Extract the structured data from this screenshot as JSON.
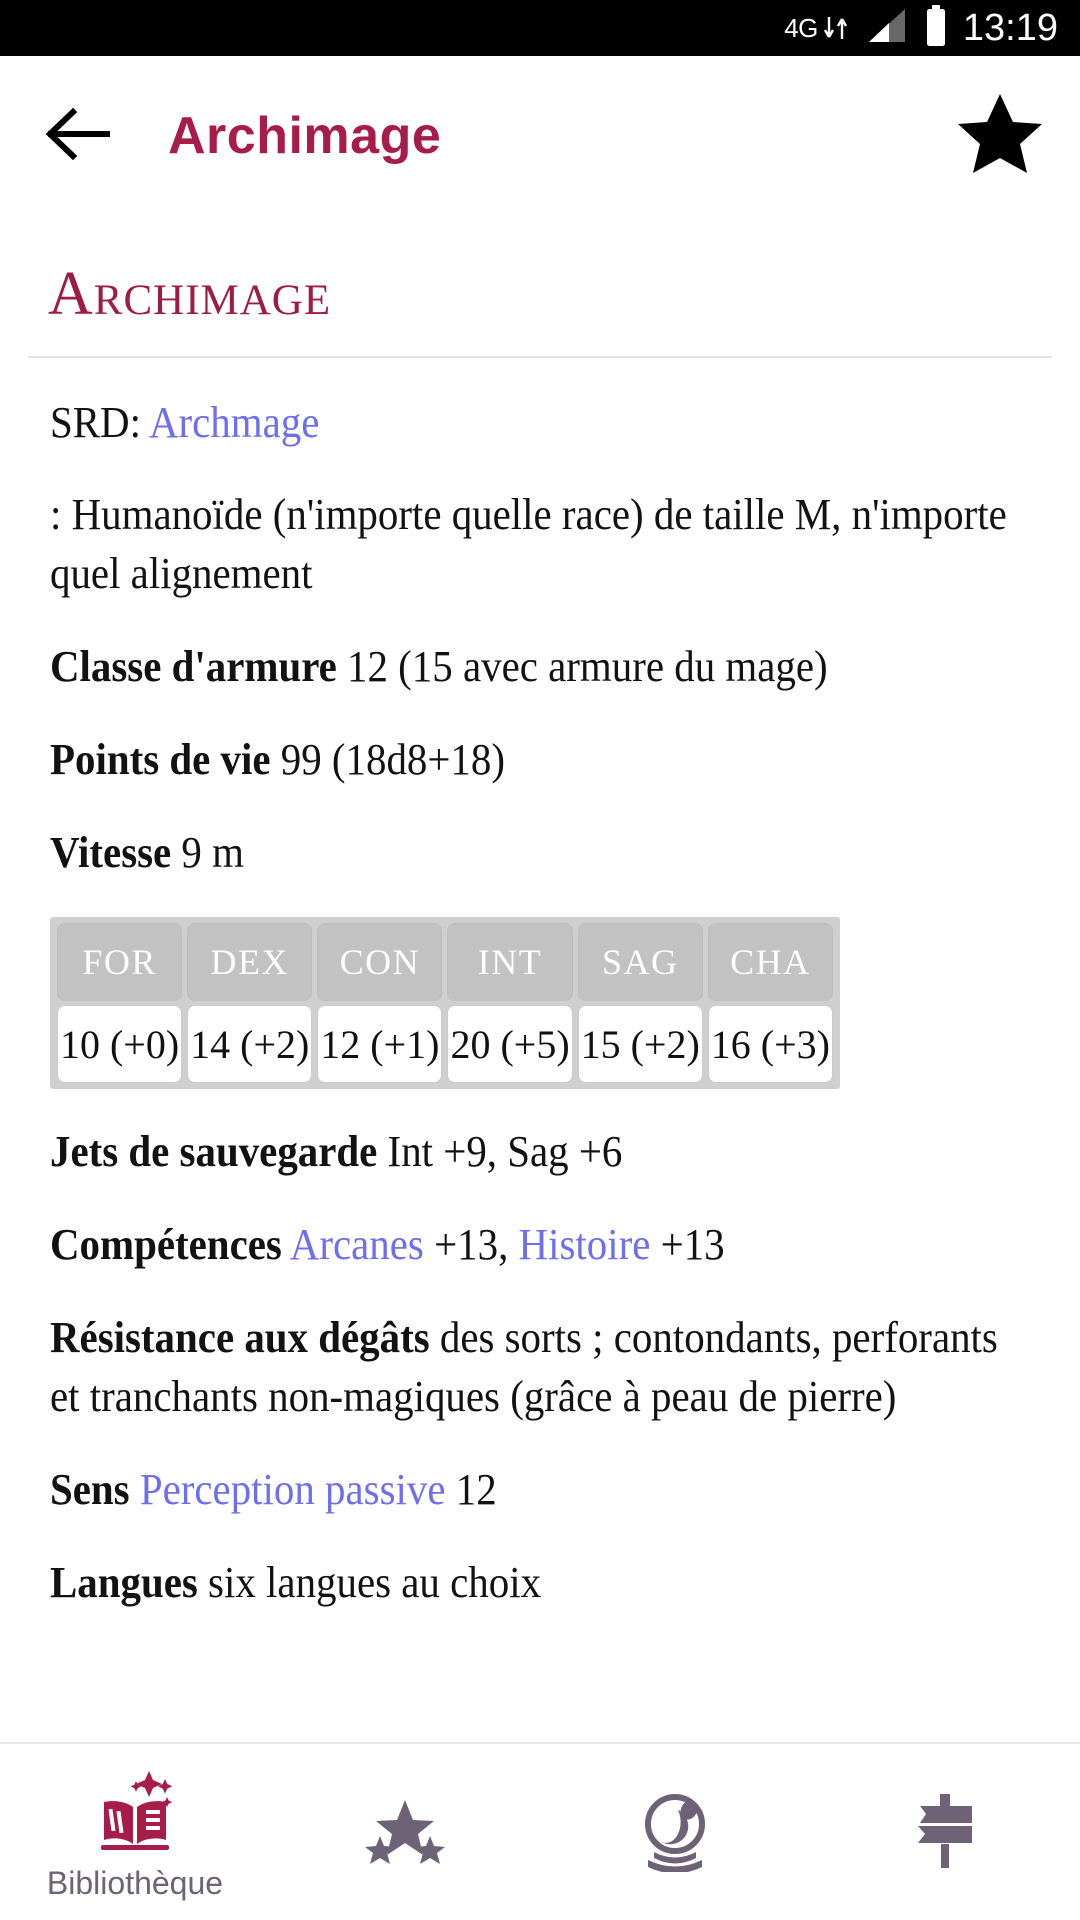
{
  "status_bar": {
    "network_label": "4G",
    "network_icon": "4g-data-arrows-icon",
    "signal_icon": "signal-bars-icon",
    "battery_icon": "battery-full-icon",
    "time": "13:19"
  },
  "app_bar": {
    "back_icon": "back-arrow-icon",
    "title": "Archimage",
    "favorite_icon": "star-filled-icon"
  },
  "statblock": {
    "title": "Archimage",
    "srd_label": "SRD:",
    "srd_link": "Archmage",
    "type_line": ": Humanoïde (n'importe quelle race) de taille M, n'importe quel alignement",
    "entries": [
      {
        "label": "Classe d'armure",
        "value": "12 (15 avec armure du mage)"
      },
      {
        "label": "Points de vie",
        "value": "99 (18d8+18)"
      },
      {
        "label": "Vitesse",
        "value": "9 m"
      }
    ],
    "abilities": {
      "headers": [
        "FOR",
        "DEX",
        "CON",
        "INT",
        "SAG",
        "CHA"
      ],
      "values": [
        "10 (+0)",
        "14 (+2)",
        "12 (+1)",
        "20 (+5)",
        "15 (+2)",
        "16 (+3)"
      ]
    },
    "saves": {
      "label": "Jets de sauvegarde",
      "value": "Int +9, Sag +6"
    },
    "skills": {
      "label": "Compétences",
      "link1": "Arcanes",
      "bonus1": "+13,",
      "link2": "Histoire",
      "bonus2": "+13"
    },
    "resistance": {
      "label": "Résistance aux dégâts",
      "value": "des sorts ; contondants, perforants et tranchants non-magiques (grâce à peau de pierre)"
    },
    "senses": {
      "label": "Sens",
      "link": "Perception passive",
      "value": "12"
    },
    "languages": {
      "label": "Langues",
      "value": "six langues au choix"
    }
  },
  "bottom_nav": [
    {
      "icon": "open-book-sparkles-icon",
      "label": "Bibliothèque",
      "active": true
    },
    {
      "icon": "three-stars-icon",
      "label": "",
      "active": false
    },
    {
      "icon": "crystal-ball-icon",
      "label": "",
      "active": false
    },
    {
      "icon": "signpost-icon",
      "label": "",
      "active": false
    }
  ],
  "colors": {
    "brand_crimson": "#a81c4a",
    "statblock_title": "#9e1c42",
    "link_blue": "#6e6ef0",
    "nav_inactive": "#6e6276",
    "table_header_bg": "#c2c2c2"
  }
}
